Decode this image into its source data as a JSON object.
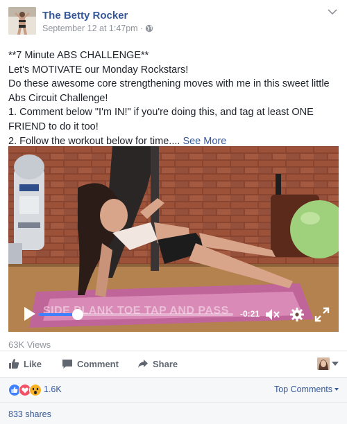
{
  "post": {
    "page_name": "The Betty Rocker",
    "timestamp": "September 12 at 1:47pm ·",
    "privacy_icon": "globe-icon",
    "text_lines": [
      "**7 Minute ABS CHALLENGE**",
      "Let's MOTIVATE our Monday Rockstars!",
      "Do these awesome core strengthening moves with me in this sweet little",
      "Abs Circuit Challenge!",
      "1. Comment below \"I'm IN!\" if you're doing this, and tag at least ONE",
      "FRIEND to do it too!",
      "2. Follow the workout below for time.... "
    ],
    "see_more": "See More"
  },
  "video": {
    "caption": "SIDE PLANK TOE TAP AND PASS",
    "time_remaining": "-0:21",
    "progress": 0.2,
    "progress_color": "#4080ff"
  },
  "stats": {
    "views": "63K Views"
  },
  "actions": {
    "like": "Like",
    "comment": "Comment",
    "share": "Share"
  },
  "reactions": {
    "types": [
      "like",
      "love",
      "wow"
    ],
    "count": "1.6K",
    "sort_label": "Top Comments"
  },
  "shares": {
    "label": "833 shares"
  },
  "colors": {
    "link": "#365899",
    "like_blue": "#4080ff",
    "love_red": "#f25268",
    "wow_yellow": "#f7b125"
  }
}
